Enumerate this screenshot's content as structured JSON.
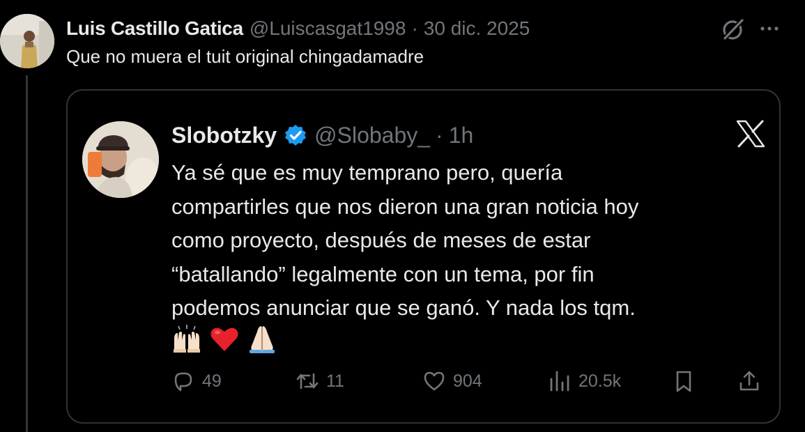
{
  "outer_tweet": {
    "author_name": "Luis Castillo Gatica",
    "handle": "@Luiscasgat1998",
    "separator": "·",
    "date": "30 dic. 2025",
    "text": "Que no muera el tuit original chingadamadre"
  },
  "quoted_tweet": {
    "author_name": "Slobotzky",
    "handle": "@Slobaby_",
    "separator": "·",
    "time": "1h",
    "text_lines": [
      "Ya sé que es muy temprano pero, quería",
      "compartirles que nos dieron una gran noticia hoy",
      "como proyecto, después de meses de estar",
      "“batallando” legalmente con un tema, por fin",
      "podemos anunciar que se ganó. Y nada los tqm."
    ],
    "emojis": [
      "raising-hands-emoji",
      "red-heart-emoji",
      "folded-hands-emoji"
    ],
    "stats": {
      "replies": "49",
      "reposts": "11",
      "likes": "904",
      "views": "20.5k"
    }
  },
  "icons": [
    "grok-icon",
    "more-icon",
    "verified-badge-icon",
    "x-logo-icon",
    "reply-icon",
    "repost-icon",
    "like-icon",
    "views-icon",
    "bookmark-icon",
    "share-icon"
  ],
  "colors": {
    "background": "#000000",
    "text_primary": "#e7e9ea",
    "text_secondary": "#71767b",
    "border": "#2f3336",
    "verified": "#1d9bf0"
  }
}
